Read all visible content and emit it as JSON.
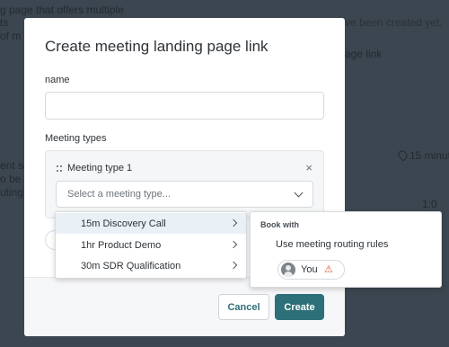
{
  "background": {
    "fragments": [
      "g page that offers multiple",
      "ts",
      "of m",
      "ve been created yet.",
      "age link",
      "15 minut",
      "ent se",
      "o be",
      "uting)",
      "1:0"
    ]
  },
  "modal": {
    "title": "Create meeting landing page link",
    "name_label": "name",
    "name_value": "",
    "meeting_types_label": "Meeting types",
    "meeting_type_title": "Meeting type 1",
    "remove_symbol": "×",
    "select_placeholder": "Select a meeting type...",
    "cancel_label": "Cancel",
    "create_label": "Create"
  },
  "dropdown": {
    "items": [
      {
        "label": "15m Discovery Call",
        "selected": true
      },
      {
        "label": "1hr Product Demo",
        "selected": false
      },
      {
        "label": "30m SDR Qualification",
        "selected": false
      }
    ]
  },
  "submenu": {
    "heading": "Book with",
    "option": "Use meeting routing rules",
    "user_label": "You",
    "warning_symbol": "⚠",
    "warning_color": "#e0542c"
  },
  "colors": {
    "accent": "#2e7079",
    "overlay": "#3c4650"
  }
}
